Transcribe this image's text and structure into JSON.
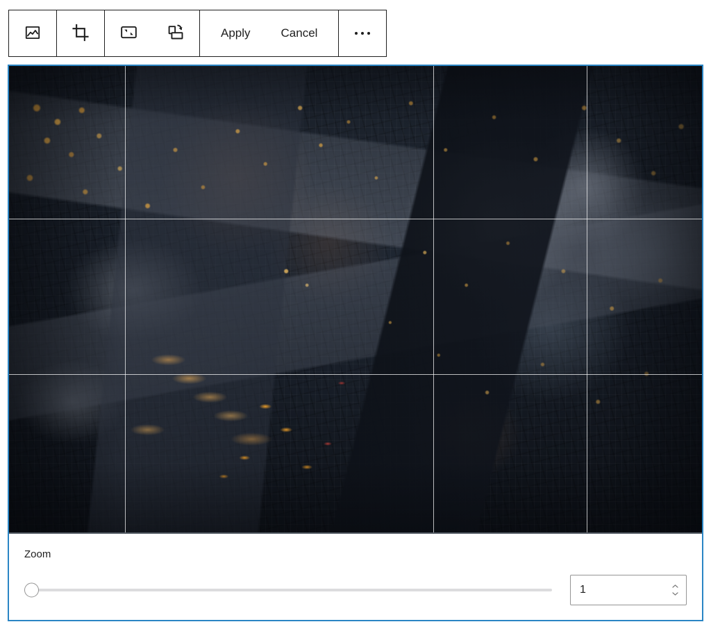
{
  "toolbar": {
    "buttons": [
      {
        "name": "image-icon",
        "label": "Image",
        "type": "icon"
      },
      {
        "name": "crop-icon",
        "label": "Crop",
        "type": "icon"
      },
      {
        "name": "aspect-ratio-icon",
        "label": "Aspect Ratio",
        "type": "icon"
      },
      {
        "name": "rotate-icon",
        "label": "Rotate",
        "type": "icon"
      }
    ],
    "apply_label": "Apply",
    "cancel_label": "Cancel",
    "more_options_label": "Options",
    "border_color": "#1e1e1e"
  },
  "editor": {
    "selected_outline_color": "#2a85c4",
    "image_alt": "Aerial view of a city at dusk with lit office windows, rooftops and a busy avenue",
    "crop_grid": {
      "visible": true,
      "line_color": "rgba(255,255,255,0.72)",
      "vertical_percent": [
        16.7,
        61.2,
        83.4
      ],
      "horizontal_percent": [
        32.7,
        66.0
      ]
    }
  },
  "controls": {
    "zoom": {
      "label": "Zoom",
      "value": "1",
      "slider_percent": 0,
      "min": "1",
      "max": "100",
      "track_color": "#dcdcde",
      "thumb_color": "#ffffff"
    }
  }
}
